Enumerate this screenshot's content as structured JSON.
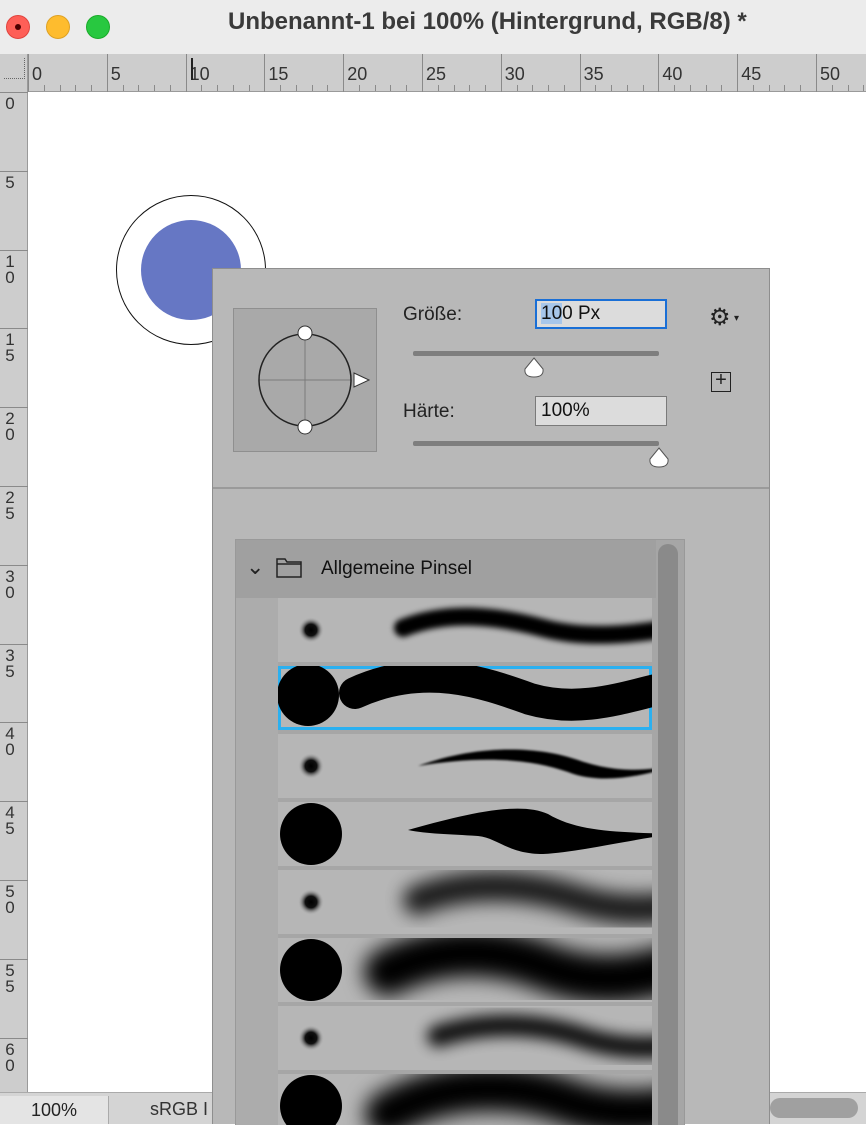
{
  "window": {
    "title": "Unbenannt-1 bei 100% (Hintergrund, RGB/8) *"
  },
  "ruler": {
    "horizontal_labels": [
      "0",
      "5",
      "10",
      "15",
      "20",
      "25",
      "30",
      "35",
      "40",
      "45",
      "50"
    ],
    "vertical_labels": [
      [
        "0"
      ],
      [
        "5"
      ],
      [
        "1",
        "0"
      ],
      [
        "1",
        "5"
      ],
      [
        "2",
        "0"
      ],
      [
        "2",
        "5"
      ],
      [
        "3",
        "0"
      ],
      [
        "3",
        "5"
      ],
      [
        "4",
        "0"
      ],
      [
        "4",
        "5"
      ],
      [
        "5",
        "0"
      ],
      [
        "5",
        "5"
      ],
      [
        "6",
        "0"
      ]
    ]
  },
  "canvas": {
    "foreground_color": "#6677c4"
  },
  "status": {
    "zoom": "100%",
    "profile": "sRGB I"
  },
  "brush_panel": {
    "size_label": "Größe:",
    "size_value": "100 Px",
    "size_selected_text": "10",
    "size_rest_text": "0 Px",
    "size_slider_value": 0.49,
    "hardness_label": "Härte:",
    "hardness_value": "100%",
    "hardness_slider_value": 1.0,
    "settings_icon": "gear-icon",
    "new_preset_icon": "plus-square-icon",
    "group": {
      "name": "Allgemeine Pinsel",
      "expanded": true
    },
    "presets": [
      {
        "kind": "soft-small",
        "stroke": "soft-thin"
      },
      {
        "kind": "hard-large",
        "stroke": "hard-thick",
        "selected": true
      },
      {
        "kind": "soft-small",
        "stroke": "tapered-thin"
      },
      {
        "kind": "hard-large",
        "stroke": "tapered-thick"
      },
      {
        "kind": "soft-small",
        "stroke": "airbrush-soft"
      },
      {
        "kind": "hard-large",
        "stroke": "airbrush-thick"
      },
      {
        "kind": "soft-small",
        "stroke": "airbrush-thin"
      },
      {
        "kind": "hard-large",
        "stroke": "airbrush-wide"
      }
    ],
    "selection_color": "#2bb0f0"
  }
}
